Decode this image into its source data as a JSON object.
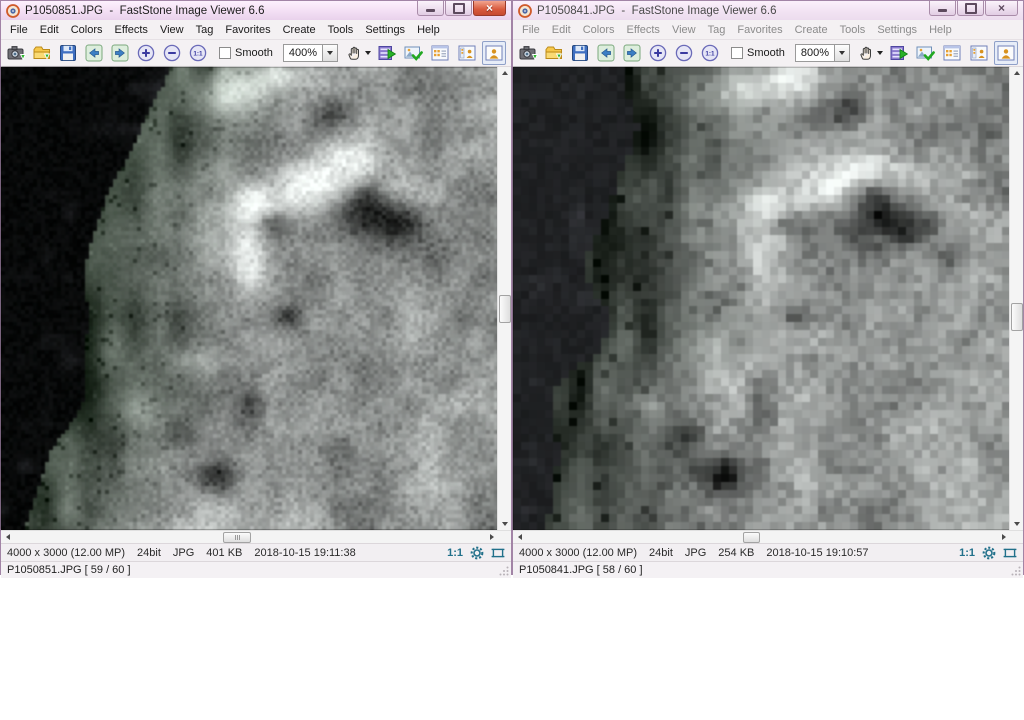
{
  "app": {
    "name": "FastStone Image Viewer",
    "version": "6.6"
  },
  "menu_items": [
    "File",
    "Edit",
    "Colors",
    "Effects",
    "View",
    "Tag",
    "Favorites",
    "Create",
    "Tools",
    "Settings",
    "Help"
  ],
  "toolbar": {
    "smooth_label": "Smooth"
  },
  "icons": {
    "dropdown_caret": "css-triangle-down",
    "scroll_arrows": "css-triangles",
    "close_glyph": "×",
    "acquire": "camera-with-green-arrow",
    "open": "folder-with-green-arrow",
    "save": "blue-floppy-disk",
    "navigation": "green-prev-next-squares",
    "zoom": "blue-circles-plus-minus-1:1",
    "hand_tool": "open-hand",
    "slideshow": "filmstrip-green-play",
    "compare": "image-with-green-check",
    "view_modes": "browser / thumbnail / image-only (pressed) / fullscreen-handles",
    "status_gear": "teal-gear",
    "status_fit": "teal-fit-rectangle"
  },
  "colors": {
    "titlebar_tint": "#f3dff4",
    "close_button": "#d8593d",
    "status_accent": "#21708a",
    "selection_green": "#2db82d",
    "window_border": "#a284a6"
  },
  "windows": {
    "left": {
      "title": "P1050851.JPG  -  FastStone Image Viewer 6.6",
      "zoom": "400%",
      "status": {
        "dimensions": "4000 x 3000 (12.00 MP)",
        "depth": "24bit",
        "format": "JPG",
        "size": "401 KB",
        "datetime": "2018-10-15 19:11:38",
        "ratio": "1:1"
      },
      "file_info": "P1050851.JPG [ 59 / 60 ]"
    },
    "right": {
      "title": "P1050841.JPG  -  FastStone Image Viewer 6.6",
      "zoom": "800%",
      "status": {
        "dimensions": "4000 x 3000 (12.00 MP)",
        "depth": "24bit",
        "format": "JPG",
        "size": "254 KB",
        "datetime": "2018-10-15 19:10:57",
        "ratio": "1:1"
      },
      "file_info": "P1050841.JPG [ 58 / 60 ]"
    }
  }
}
